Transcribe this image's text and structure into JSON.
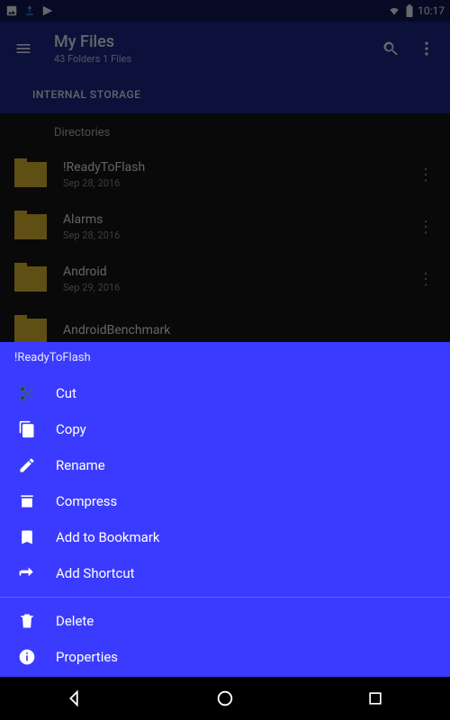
{
  "status": {
    "time": "10:17"
  },
  "appbar": {
    "title": "My Files",
    "subtitle": "43 Folders 1 Files"
  },
  "tab": {
    "label": "INTERNAL STORAGE"
  },
  "list": {
    "section": "Directories",
    "items": [
      {
        "name": "!ReadyToFlash",
        "date": "Sep 28, 2016"
      },
      {
        "name": "Alarms",
        "date": "Sep 28, 2016"
      },
      {
        "name": "Android",
        "date": "Sep 29, 2016"
      },
      {
        "name": "AndroidBenchmark",
        "date": ""
      }
    ]
  },
  "sheet": {
    "target": "!ReadyToFlash",
    "actions": {
      "cut": "Cut",
      "copy": "Copy",
      "rename": "Rename",
      "compress": "Compress",
      "bookmark": "Add to Bookmark",
      "shortcut": "Add Shortcut",
      "delete": "Delete",
      "properties": "Properties"
    }
  }
}
